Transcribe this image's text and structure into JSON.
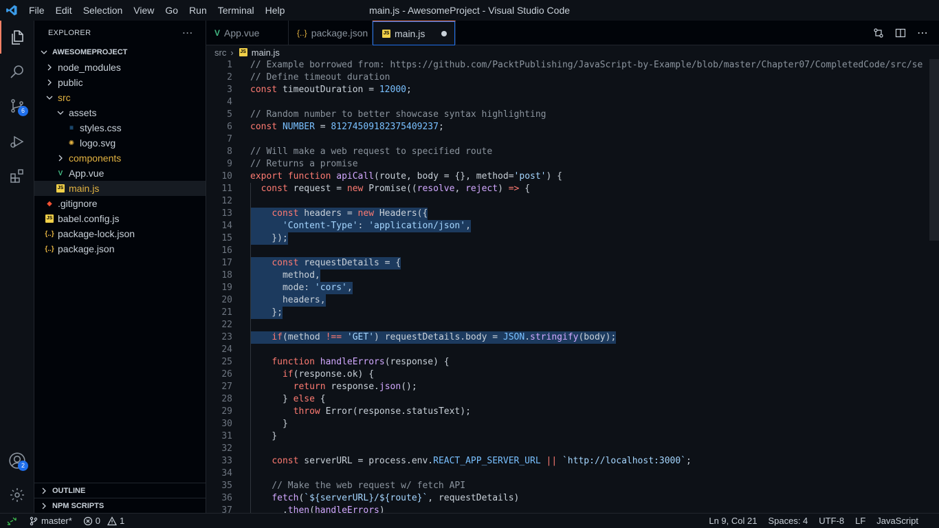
{
  "window": {
    "title": "main.js - AwesomeProject - Visual Studio Code",
    "menu": [
      "File",
      "Edit",
      "Selection",
      "View",
      "Go",
      "Run",
      "Terminal",
      "Help"
    ]
  },
  "activity_bar": {
    "items": [
      {
        "name": "explorer",
        "icon": "files-icon",
        "active": true
      },
      {
        "name": "search",
        "icon": "search-icon"
      },
      {
        "name": "source-control",
        "icon": "source-control-icon",
        "badge": "6"
      },
      {
        "name": "run-debug",
        "icon": "debug-icon"
      },
      {
        "name": "extensions",
        "icon": "extensions-icon"
      }
    ],
    "accounts_badge": "2"
  },
  "sidebar": {
    "title": "EXPLORER",
    "project": "AWESOMEPROJECT",
    "tree": [
      {
        "label": "node_modules",
        "depth": 0,
        "kind": "folder",
        "open": false
      },
      {
        "label": "public",
        "depth": 0,
        "kind": "folder",
        "open": false
      },
      {
        "label": "src",
        "depth": 0,
        "kind": "folder",
        "open": true,
        "color": "#e3b341"
      },
      {
        "label": "assets",
        "depth": 1,
        "kind": "folder",
        "open": true
      },
      {
        "label": "styles.css",
        "depth": 2,
        "kind": "css"
      },
      {
        "label": "logo.svg",
        "depth": 2,
        "kind": "svg"
      },
      {
        "label": "components",
        "depth": 1,
        "kind": "folder",
        "open": false,
        "color": "#e3b341"
      },
      {
        "label": "App.vue",
        "depth": 1,
        "kind": "vue"
      },
      {
        "label": "main.js",
        "depth": 1,
        "kind": "js",
        "selected": true,
        "color": "#e3b341"
      },
      {
        "label": ".gitignore",
        "depth": 0,
        "kind": "git"
      },
      {
        "label": "babel.config.js",
        "depth": 0,
        "kind": "js"
      },
      {
        "label": "package-lock.json",
        "depth": 0,
        "kind": "json"
      },
      {
        "label": "package.json",
        "depth": 0,
        "kind": "json"
      }
    ],
    "sections": [
      "OUTLINE",
      "NPM SCRIPTS"
    ]
  },
  "tabs": [
    {
      "label": "App.vue",
      "kind": "vue",
      "active": false
    },
    {
      "label": "package.json",
      "kind": "json",
      "active": false
    },
    {
      "label": "main.js",
      "kind": "js",
      "active": true,
      "dirty": true
    }
  ],
  "breadcrumb": [
    "src",
    "main.js"
  ],
  "editor": {
    "lines": [
      {
        "n": "1",
        "text": "// Example borrowed from: https://github.com/PacktPublishing/JavaScript-by-Example/blob/master/Chapter07/CompletedCode/src/se"
      },
      {
        "n": "2",
        "text": "// Define timeout duration"
      },
      {
        "n": "3",
        "text": "const timeoutDuration = 12000;"
      },
      {
        "n": "4",
        "text": ""
      },
      {
        "n": "5",
        "text": "// Random number to better showcase syntax highlighting"
      },
      {
        "n": "6",
        "text": "const NUMBER = 812745091823754092​37;"
      },
      {
        "n": "7",
        "text": ""
      },
      {
        "n": "8",
        "text": "// Will make a web request to specified route"
      },
      {
        "n": "9",
        "text": "// Returns a promise"
      },
      {
        "n": "10",
        "text": "export function apiCall(route, body = {}, method='post') {"
      },
      {
        "n": "11",
        "text": "  const request = new Promise((resolve, reject) => {"
      },
      {
        "n": "12",
        "text": ""
      },
      {
        "n": "13",
        "text": "    const headers = new Headers({"
      },
      {
        "n": "14",
        "text": "      'Content-Type': 'application/json',"
      },
      {
        "n": "15",
        "text": "    });"
      },
      {
        "n": "16",
        "text": ""
      },
      {
        "n": "17",
        "text": "    const requestDetails = {"
      },
      {
        "n": "18",
        "text": "      method,"
      },
      {
        "n": "19",
        "text": "      mode: 'cors',"
      },
      {
        "n": "20",
        "text": "      headers,"
      },
      {
        "n": "21",
        "text": "    };"
      },
      {
        "n": "22",
        "text": ""
      },
      {
        "n": "23",
        "text": "    if(method !== 'GET') requestDetails.body = JSON.stringify(body);"
      },
      {
        "n": "24",
        "text": ""
      },
      {
        "n": "25",
        "text": "    function handleErrors(response) {"
      },
      {
        "n": "26",
        "text": "      if(response.ok) {"
      },
      {
        "n": "27",
        "text": "        return response.json();"
      },
      {
        "n": "28",
        "text": "      } else {"
      },
      {
        "n": "29",
        "text": "        throw Error(response.statusText);"
      },
      {
        "n": "30",
        "text": "      }"
      },
      {
        "n": "31",
        "text": "    }"
      },
      {
        "n": "32",
        "text": ""
      },
      {
        "n": "33",
        "text": "    const serverURL = process.env.REACT_APP_SERVER_URL || `http://localhost:3000`;"
      },
      {
        "n": "34",
        "text": ""
      },
      {
        "n": "35",
        "text": "    // Make the web request w/ fetch API"
      },
      {
        "n": "36",
        "text": "    fetch(`${serverURL}/${route}`, requestDetails)"
      },
      {
        "n": "37",
        "text": "      .then(handleErrors)"
      }
    ]
  },
  "statusbar": {
    "branch": "master*",
    "errors": "0",
    "warnings": "1",
    "cursor": "Ln 9, Col 21",
    "spaces": "Spaces: 4",
    "encoding": "UTF-8",
    "eol": "LF",
    "language": "JavaScript"
  },
  "colors": {
    "accent": "#1f6feb",
    "tab_active_border": "#f78166",
    "selection": "#1c3a5e"
  }
}
